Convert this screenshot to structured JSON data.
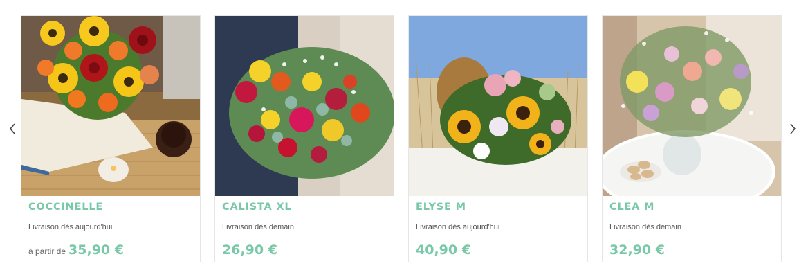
{
  "carousel": {
    "prev_icon": "chevron-left-icon",
    "next_icon": "chevron-right-icon",
    "accent_color": "#79c8a8",
    "products": [
      {
        "name": "COCCINELLE",
        "delivery": "Livraison dès aujourd'hui",
        "price_prefix": "à partir de",
        "price": "35,90 €",
        "image": "flower-bouquet-image"
      },
      {
        "name": "CALISTA XL",
        "delivery": "Livraison dès demain",
        "price_prefix": "",
        "price": "26,90 €",
        "image": "flower-bouquet-image"
      },
      {
        "name": "ELYSE M",
        "delivery": "Livraison dès aujourd'hui",
        "price_prefix": "",
        "price": "40,90 €",
        "image": "flower-bouquet-image"
      },
      {
        "name": "CLEA M",
        "delivery": "Livraison dès demain",
        "price_prefix": "",
        "price": "32,90 €",
        "image": "flower-bouquet-image"
      }
    ]
  }
}
